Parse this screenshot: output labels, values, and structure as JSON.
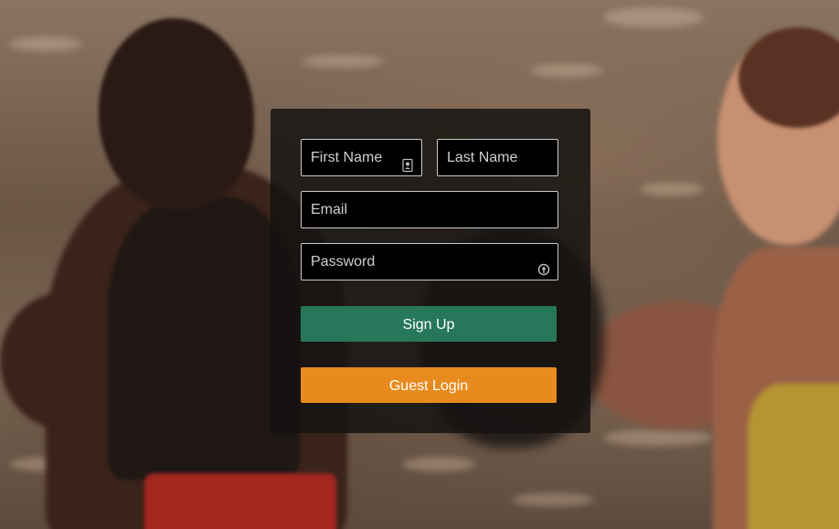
{
  "form": {
    "first_name_placeholder": "First Name",
    "last_name_placeholder": "Last Name",
    "email_placeholder": "Email",
    "password_placeholder": "Password",
    "sign_up_label": "Sign Up",
    "guest_login_label": "Guest Login"
  },
  "colors": {
    "sign_up": "#27785a",
    "guest_login": "#e88a1d"
  },
  "icons": {
    "first_name": "contact-card-icon",
    "password": "key-icon"
  }
}
